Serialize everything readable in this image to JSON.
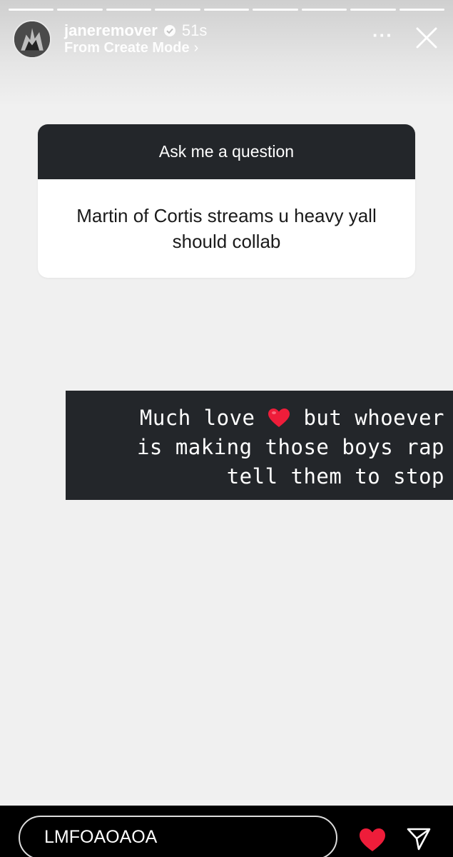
{
  "story": {
    "progress_segments": 9,
    "header": {
      "username": "janeremover",
      "time": "51s",
      "subtitle": "From Create Mode",
      "subtitle_chevron": "›",
      "more_label": "···"
    },
    "question": {
      "prompt": "Ask me a question",
      "answer": "Martin of Cortis streams u heavy yall should collab"
    },
    "reply": {
      "line1_before_emoji": "Much love",
      "emoji": "red-heart",
      "line1_after_emoji": "but whoever",
      "line2": "is making those boys rap",
      "line3": "tell them to stop"
    }
  },
  "footer": {
    "message_value": "LMFOAOAOA",
    "like_active": true
  },
  "colors": {
    "story_bg": "#f0f0f0",
    "box_dark": "#23262a",
    "heart_red": "#ee1d3a",
    "footer_bg": "#000000"
  }
}
